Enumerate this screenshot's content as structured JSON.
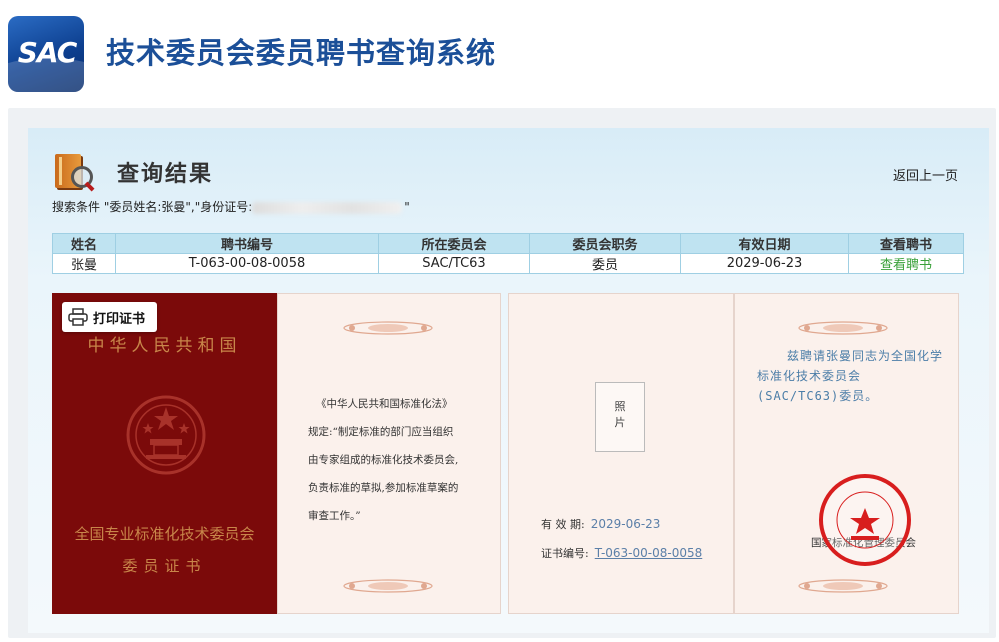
{
  "header": {
    "logo_text": "SAC",
    "title": "技术委员会委员聘书查询系统"
  },
  "result": {
    "heading": "查询结果",
    "back_link": "返回上一页",
    "search_prefix": "搜索条件 \"委员姓名:张曼\",\"身份证号:",
    "search_suffix": "\""
  },
  "table": {
    "headers": [
      "姓名",
      "聘书编号",
      "所在委员会",
      "委员会职务",
      "有效日期",
      "查看聘书"
    ],
    "row": {
      "name": "张曼",
      "cert_no": "T-063-00-08-0058",
      "committee": "SAC/TC63",
      "position": "委员",
      "valid_date": "2029-06-23",
      "view": "查看聘书"
    }
  },
  "print_button": "打印证书",
  "certificate": {
    "cover_country": "中华人民共和国",
    "cover_org": "全国专业标准化技术委员会",
    "cover_title": "委员证书",
    "law_title": "《中华人民共和国标准化法》",
    "law_lines": [
      "规定:“制定标准的部门应当组织",
      "由专家组成的标准化技术委员会,",
      "负责标准的草拟,参加标准草案的",
      "审查工作。”"
    ],
    "photo_chars": [
      "照",
      "片"
    ],
    "valid_label": "有 效 期:",
    "valid_value": "2029-06-23",
    "cert_no_label": "证书编号:",
    "cert_no_value": "T-063-00-08-0058",
    "invitation": "兹聘请张曼同志为全国化学标准化技术委员会(SAC/TC63)委员。",
    "issuer": "国家标准化管理委员会",
    "seal_text": "国家标准化管理委员会"
  },
  "colors": {
    "title_blue": "#1b4f98",
    "cover_red": "#7b0a0a",
    "gold": "#c8864a",
    "table_header": "#bfe3f1",
    "link_green": "#3aa13a",
    "seal_red": "#d81e1e"
  }
}
